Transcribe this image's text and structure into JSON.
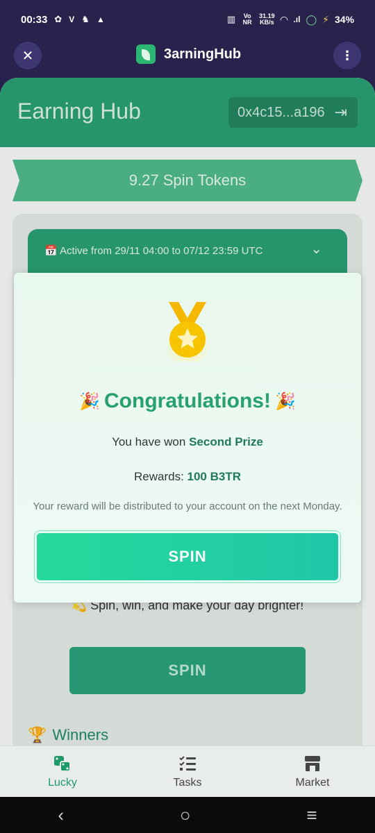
{
  "status_bar": {
    "time": "00:33",
    "left_icons": [
      "settings-icon",
      "v-icon",
      "notification-icon",
      "cloud-icon"
    ],
    "net_top": "31.19",
    "net_bottom": "KB/s",
    "vo_lte": "Vo NR",
    "battery": "34%"
  },
  "app_bar": {
    "title": "3arningHub"
  },
  "header": {
    "title": "Earning Hub",
    "wallet": "0x4c15...a196"
  },
  "tokens": {
    "label": "9.27 Spin Tokens"
  },
  "event": {
    "active": "Active from 29/11 04:00 to 07/12 23:59 UTC"
  },
  "page": {
    "tagline": "Spin, win, and make your day brighter!",
    "spin_label": "SPIN",
    "winners_label": "Winners"
  },
  "modal": {
    "title": "Congratulations!",
    "won_prefix": "You have won ",
    "prize": "Second Prize",
    "rewards_label": "Rewards: ",
    "reward_value": "100 B3TR",
    "note": "Your reward will be distributed to your account on the next Monday.",
    "spin_label": "SPIN"
  },
  "bottom_nav": [
    {
      "label": "Lucky",
      "icon": "dice-icon",
      "active": true
    },
    {
      "label": "Tasks",
      "icon": "checklist-icon",
      "active": false
    },
    {
      "label": "Market",
      "icon": "store-icon",
      "active": false
    }
  ],
  "colors": {
    "accent": "#27a16d",
    "app_bar": "#28224d",
    "header": "#2a9f73"
  }
}
